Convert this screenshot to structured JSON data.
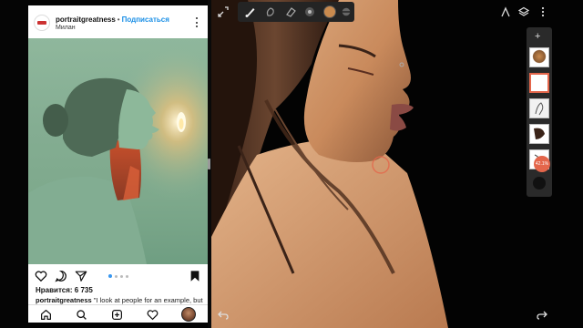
{
  "instagram": {
    "username": "portraitgreatness",
    "separator": "•",
    "follow_label": "Подписаться",
    "location": "Милан",
    "likes_text": "Нравится: 6 735",
    "caption_user": "portraitgreatness",
    "caption_text": "\"I look at people for an example, but",
    "carousel_dots": 4,
    "carousel_active": 1,
    "icons": {
      "like": "heart-icon",
      "comment": "comment-icon",
      "share": "share-icon",
      "save": "bookmark-icon",
      "home": "home-icon",
      "search": "search-icon",
      "add": "add-post-icon",
      "activity": "heart-icon",
      "profile": "profile-avatar"
    }
  },
  "drawing_app": {
    "toolbar_tools": [
      "brush-icon",
      "smudge-icon",
      "eraser-icon",
      "brush-size-icon",
      "color-swatch",
      "opacity-icon"
    ],
    "current_color": "#c98a4e",
    "top_right_icons": [
      "ruler-icon",
      "layers-icon",
      "more-icon"
    ],
    "layers_badge": "42.1%",
    "accent_color": "#e4664b"
  }
}
